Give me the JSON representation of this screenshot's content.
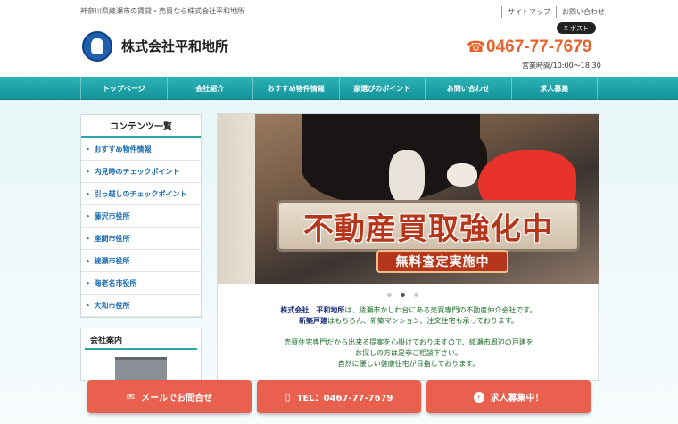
{
  "header": {
    "tagline": "神奈川県綾瀬市の賃貸・売買なら株式会社平和地所",
    "links": [
      "サイトマップ",
      "お問い合わせ"
    ],
    "company_name": "株式会社平和地所",
    "x_post": "X ポスト",
    "phone": "0467-77-7679",
    "hours": "営業時間/10:00～18:30"
  },
  "nav": {
    "items": [
      "トップページ",
      "会社紹介",
      "おすすめ物件情報",
      "家選びのポイント",
      "お問い合わせ",
      "求人募集"
    ]
  },
  "sidebar": {
    "title": "コンテンツ一覧",
    "items": [
      "おすすめ物件情報",
      "内見時のチェックポイント",
      "引っ越しのチェックポイント",
      "藤沢市役所",
      "座間市役所",
      "綾瀬市役所",
      "海老名市役所",
      "大和市役所"
    ],
    "company_title": "会社案内"
  },
  "slider": {
    "headline": "不動産買取強化中",
    "sub": "無料査定実施中"
  },
  "intro": {
    "line1_a": "株式会社　平和地所",
    "line1_b": "は、綾瀬市かしわ台にある売買専門の不動産仲介会社です。",
    "line2_a": "新築戸建",
    "line2_b": "はもちろん、新築マンション、注文住宅も承っております。",
    "line3": "売買住宅専門だから出来る提案を心掛けておりますので、綾瀬市周辺の戸建を",
    "line4": "お探しの方は是非ご相談下さい。",
    "line5": "自然に優しい健康住宅が目指しております。"
  },
  "cta": {
    "mail": "メールでお問合せ",
    "tel": "TEL：0467-77-7679",
    "recruit": "求人募集中！"
  },
  "colors": {
    "accent": "#e8632b",
    "nav": "#1ba3a8",
    "cta": "#e9604f"
  }
}
